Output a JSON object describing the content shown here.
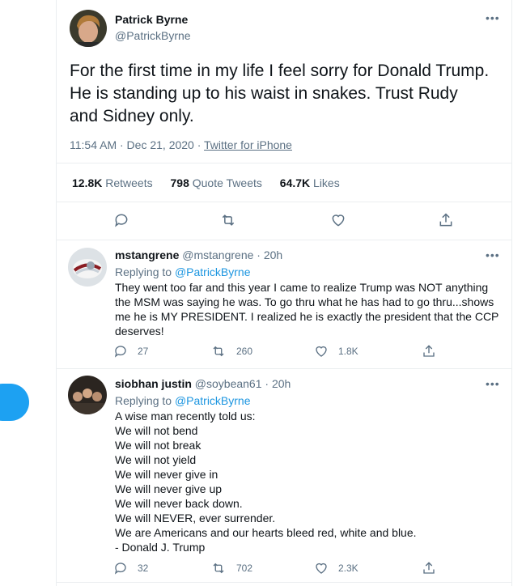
{
  "main_tweet": {
    "name": "Patrick Byrne",
    "handle": "@PatrickByrne",
    "text": "For the first time in my life I feel sorry for Donald Trump. He is standing up to his waist in snakes. Trust Rudy and Sidney only.",
    "time": "11:54 AM · Dec 21, 2020 · ",
    "client": "Twitter for iPhone",
    "retweets": "12.8K",
    "retweets_label": "Retweets",
    "quotes": "798",
    "quotes_label": "Quote Tweets",
    "likes": "64.7K",
    "likes_label": "Likes"
  },
  "replies": [
    {
      "name": "mstangrene",
      "handle": "@mstangrene",
      "time": " · 20h",
      "replying_prefix": "Replying to ",
      "replying_to": "@PatrickByrne",
      "lines": [
        "They went too far and this year I came to realize Trump was NOT anything",
        "the MSM was saying he was.  To go thru what he has had to go thru...shows",
        "me he is MY PRESIDENT.  I realized he is exactly the president that the CCP",
        "deserves!"
      ],
      "reply_count": "27",
      "retweet_count": "260",
      "like_count": "1.8K"
    },
    {
      "name": "siobhan justin",
      "handle": "@soybean61",
      "time": " · 20h",
      "replying_prefix": "Replying to ",
      "replying_to": "@PatrickByrne",
      "lines": [
        "A wise man recently told us:",
        "We will not bend",
        "We will not break",
        "We will not yield",
        "We will never give in",
        "We will never give up",
        "We will never back down.",
        "We will NEVER, ever surrender.",
        "We are Americans and our hearts bleed red, white and blue.",
        "- Donald J. Trump"
      ],
      "reply_count": "32",
      "retweet_count": "702",
      "like_count": "2.3K"
    }
  ],
  "icons": {
    "more": "more-dots-icon",
    "reply": "reply-icon",
    "retweet": "retweet-icon",
    "like": "heart-icon",
    "share": "share-icon"
  },
  "colors": {
    "accent": "#1da1f2",
    "link": "#1b95e0",
    "muted": "#5b7083"
  }
}
